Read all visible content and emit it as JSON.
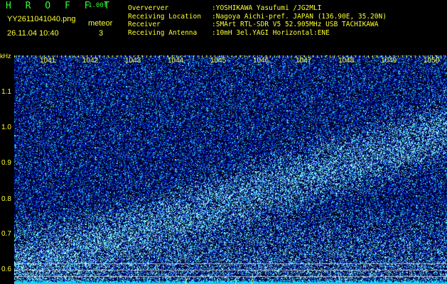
{
  "header": {
    "brand": "H R O F F T",
    "version": "1.00f",
    "filename": "YY2611041040.png",
    "datetime": "26.11.04 10:40",
    "meteor_label": "meteor",
    "meteor_count": "3",
    "info": [
      {
        "key": "Oververver",
        "value": ":YOSHIKAWA Yasufumi /JG2MLI"
      },
      {
        "key": "Receiving Location",
        "value": ":Nagoya Aichi-pref. JAPAN (136.90E, 35.20N)"
      },
      {
        "key": "Receiver",
        "value": ":SMArt RTL-SDR V5 52.905MHz USB TACHIKAWA"
      },
      {
        "key": "Receiving Antenna",
        "value": ":10mH 3el.YAGI Horizontal:ENE"
      }
    ]
  },
  "plot": {
    "y_unit": "kHz",
    "y_ticks": [
      "1.1",
      "1.0",
      "0.9",
      "0.8",
      "0.7",
      "0.6"
    ],
    "x_ticks": [
      "1041",
      "1042",
      "1043",
      "1044",
      "1045",
      "1046",
      "1047",
      "1048",
      "1049",
      "1050"
    ]
  }
}
